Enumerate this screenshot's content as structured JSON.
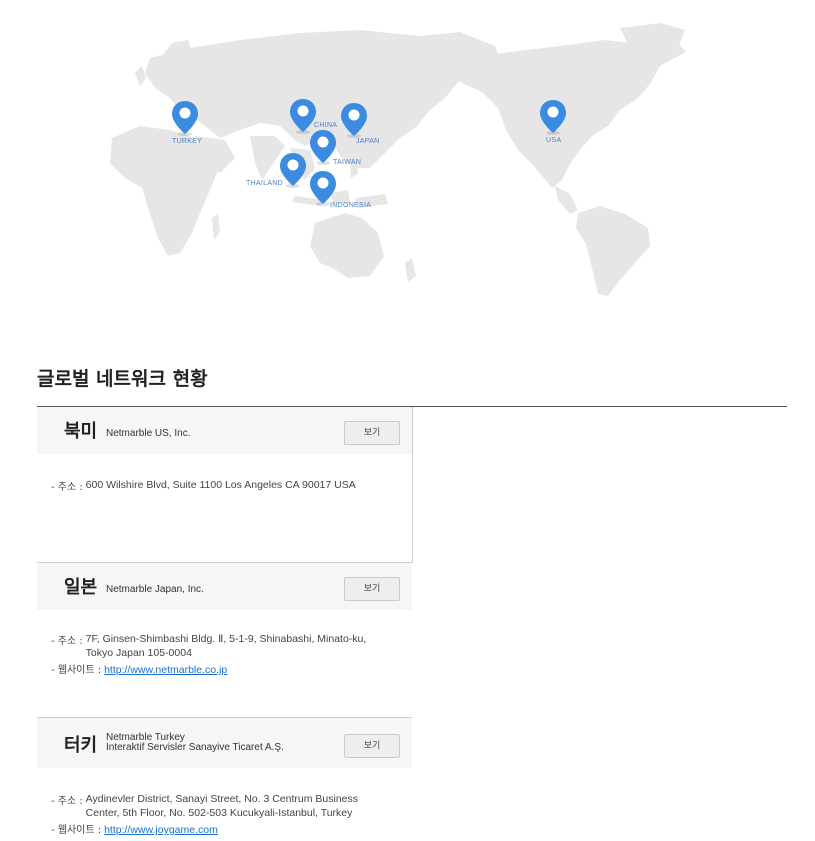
{
  "map": {
    "markers": [
      {
        "id": "turkey",
        "label": "TURKEY"
      },
      {
        "id": "china",
        "label": "CHINA"
      },
      {
        "id": "japan",
        "label": "JAPAN"
      },
      {
        "id": "taiwan",
        "label": "TAIWAN"
      },
      {
        "id": "thailand",
        "label": "THAILAND"
      },
      {
        "id": "indonesia",
        "label": "INDONESIA"
      },
      {
        "id": "usa",
        "label": "USA"
      }
    ],
    "marker_color": "#3b8be0",
    "land_color": "#e6e6e6"
  },
  "section": {
    "title": "글로벌 네트워크 현황"
  },
  "offices": [
    {
      "region": "북미",
      "company": "Netmarble US, Inc.",
      "view_label": "보기",
      "address_label": "- 주소 :",
      "address_lines": [
        "600 Wilshire Blvd, Suite 1100 Los Angeles CA 90017 USA"
      ]
    },
    {
      "region": "일본",
      "company": "Netmarble Japan, Inc.",
      "view_label": "보기",
      "address_label": "- 주소 :",
      "address_lines": [
        "7F, Ginsen-Shimbashi Bldg. Ⅱ, 5-1-9, Shinabashi, Minato-ku,",
        "Tokyo Japan 105-0004"
      ],
      "website_label": "- 웹사이트 :",
      "website": "http://www.netmarble.co.jp"
    },
    {
      "region": "터키",
      "company_lines": [
        "Netmarble Turkey",
        "Interaktif Servisler Sanayive Ticaret A.Ş."
      ],
      "view_label": "보기",
      "address_label": "- 주소 :",
      "address_lines": [
        "Aydinevler District, Sanayi Street, No. 3 Centrum Business",
        "Center, 5th Floor, No. 502-503 Kucukyali-Istanbul, Turkey"
      ],
      "website_label": "- 웹사이트 :",
      "website": "http://www.joygame.com"
    }
  ]
}
